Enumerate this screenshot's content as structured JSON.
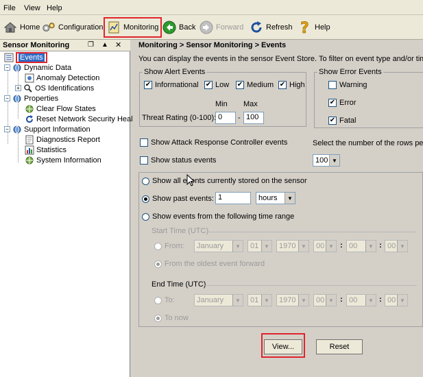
{
  "menu": {
    "file": "File",
    "view": "View",
    "help": "Help"
  },
  "toolbar": {
    "home": "Home",
    "configuration": "Configuration",
    "monitoring": "Monitoring",
    "back": "Back",
    "forward": "Forward",
    "refresh": "Refresh",
    "help": "Help"
  },
  "left_pane": {
    "title": "Sensor Monitoring",
    "items": {
      "events": "Events",
      "dynamic_data": "Dynamic Data",
      "anomaly_detection": "Anomaly Detection",
      "os_identifications": "OS Identifications",
      "properties": "Properties",
      "clear_flow_states": "Clear Flow States",
      "reset_network_security": "Reset Network Security Heal",
      "support_information": "Support Information",
      "diagnostics_report": "Diagnostics Report",
      "statistics": "Statistics",
      "system_information": "System Information"
    }
  },
  "main": {
    "breadcrumb": "Monitoring > Sensor Monitoring > Events",
    "description": "You can display the events in the sensor Event Store. To filter on event type and/or time, se",
    "alert_events": {
      "title": "Show Alert Events",
      "informational": "Informational",
      "low": "Low",
      "medium": "Medium",
      "high": "High",
      "min_label": "Min",
      "max_label": "Max",
      "threat_label": "Threat Rating (0-100):",
      "min_value": "0",
      "max_value": "100",
      "dash": "-"
    },
    "error_events": {
      "title": "Show Error Events",
      "warning": "Warning",
      "error": "Error",
      "fatal": "Fatal"
    },
    "attack_response": "Show Attack Response Controller events",
    "status_events": "Show status events",
    "rows_label": "Select the number of the rows per p",
    "rows_value": "100",
    "show_all": "Show all events currently stored on the sensor",
    "show_past": "Show past events:",
    "past_value": "1",
    "past_unit": "hours",
    "show_range": "Show events from the following time range",
    "start_time": {
      "title": "Start Time (UTC)",
      "from": "From:",
      "month": "January",
      "day": "01",
      "year": "1970",
      "hh": "00",
      "mm": "00",
      "ss": "00",
      "oldest": "From the oldest event forward",
      "colon": ":"
    },
    "end_time": {
      "title": "End Time (UTC)",
      "to": "To:",
      "month": "January",
      "day": "01",
      "year": "1970",
      "hh": "00",
      "mm": "00",
      "ss": "00",
      "to_now": "To now",
      "colon": ":"
    },
    "view_button": "View...",
    "reset_button": "Reset"
  }
}
